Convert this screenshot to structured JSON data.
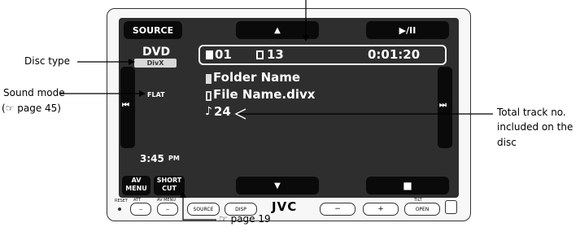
{
  "device": {
    "source_label": "SOURCE",
    "disc_type": "DVD",
    "disc_subtype": "DivX",
    "sound_mode": "FLAT",
    "folder_no": "01",
    "file_no": "13",
    "time": "0:01:20",
    "folder_name": "Folder Name",
    "file_name": "File Name.divx",
    "track_total": "24",
    "clock": "3:45",
    "clock_suffix": "PM",
    "av_menu": [
      "AV",
      "MENU"
    ],
    "short_cut": [
      "SHORT",
      "CUT"
    ],
    "up_glyph": "▲",
    "down_glyph": "▼",
    "play_pause_glyph": "▶/II",
    "stop_glyph": "■",
    "prev_glyph": "⏮",
    "next_glyph": "⏭",
    "brand": "JVC",
    "bottom_buttons": {
      "source": "SOURCE",
      "disp": "DISP",
      "minus": "−",
      "plus": "+",
      "open": "OPEN"
    },
    "bottom_small_labels": {
      "reset": "RESET",
      "att": "ATT",
      "av_menu": "AV MENU",
      "tilt": "TILT"
    }
  },
  "annotations": {
    "disc_type": "Disc type",
    "sound_mode_line1": "Sound mode",
    "sound_mode_line2": "(☞ page 45)",
    "total_track_line1": "Total track no.",
    "total_track_line2": "included on the",
    "total_track_line3": "disc",
    "page_ref": "☞ page 19"
  }
}
